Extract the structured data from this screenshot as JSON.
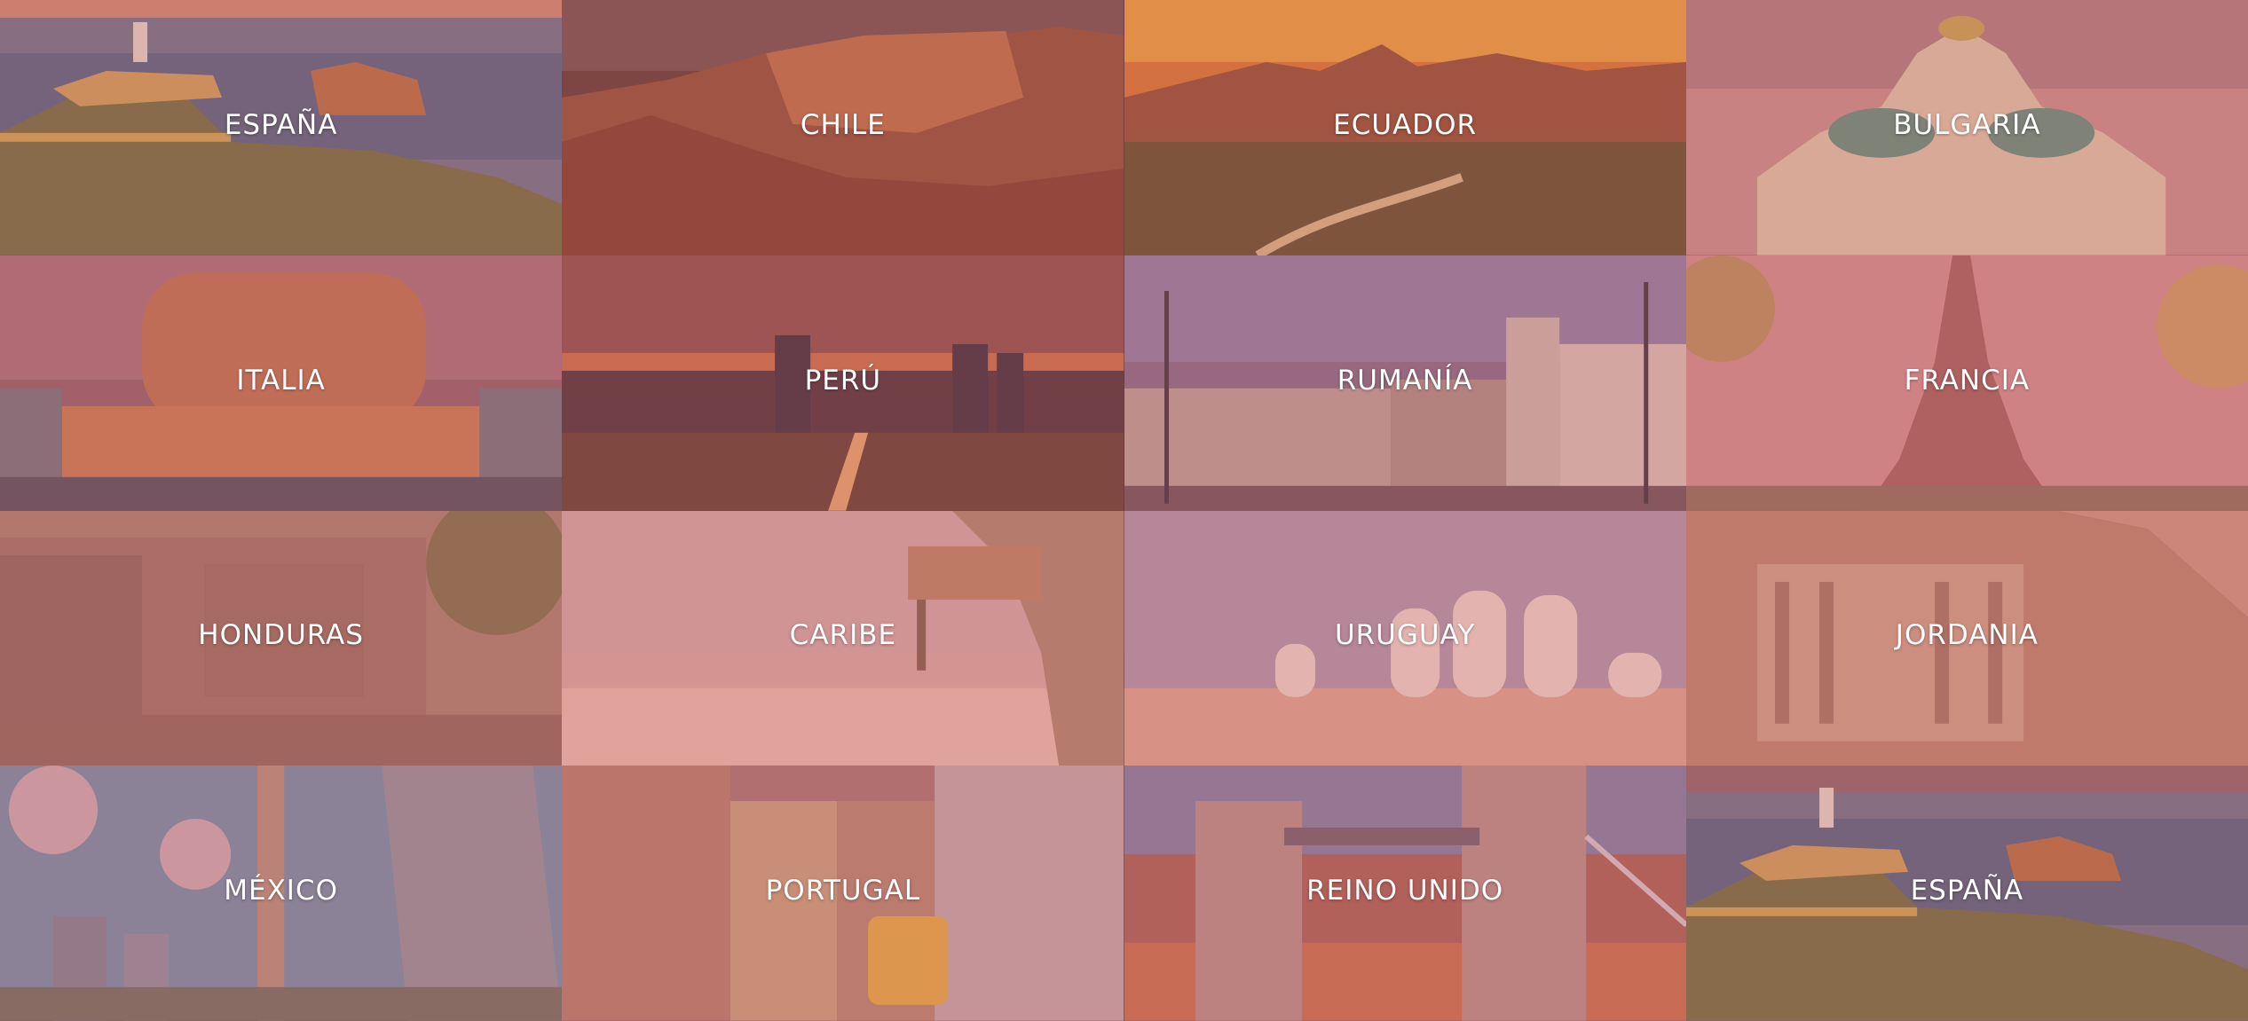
{
  "destinations": [
    {
      "label": "ESPAÑA"
    },
    {
      "label": "CHILE"
    },
    {
      "label": "ECUADOR"
    },
    {
      "label": "BULGARIA"
    },
    {
      "label": "ITALIA"
    },
    {
      "label": "PERÚ"
    },
    {
      "label": "RUMANÍA"
    },
    {
      "label": "FRANCIA"
    },
    {
      "label": "HONDURAS"
    },
    {
      "label": "CARIBE"
    },
    {
      "label": "URUGUAY"
    },
    {
      "label": "JORDANIA"
    },
    {
      "label": "MÉXICO"
    },
    {
      "label": "PORTUGAL"
    },
    {
      "label": "REINO UNIDO"
    },
    {
      "label": "ESPAÑA"
    }
  ],
  "theme": {
    "overlay": "#d66e6e",
    "text": "#ffffff"
  }
}
